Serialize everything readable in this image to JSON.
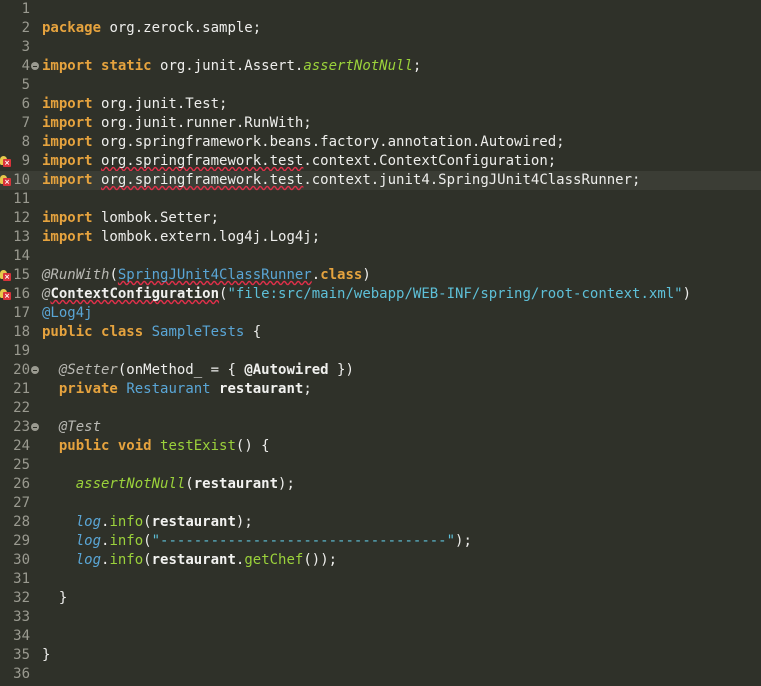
{
  "editor": {
    "lines": [
      {
        "num": "1",
        "tokens": []
      },
      {
        "num": "2",
        "tokens": [
          {
            "t": "package",
            "c": "kw"
          },
          {
            "t": " org.zerock.sample;",
            "c": "pl"
          }
        ]
      },
      {
        "num": "3",
        "tokens": []
      },
      {
        "num": "4",
        "fold": true,
        "tokens": [
          {
            "t": "import",
            "c": "kw"
          },
          {
            "t": " ",
            "c": "pl"
          },
          {
            "t": "static",
            "c": "kw"
          },
          {
            "t": " org.junit.Assert.",
            "c": "pl"
          },
          {
            "t": "assertNotNull",
            "c": "sm"
          },
          {
            "t": ";",
            "c": "pl"
          }
        ]
      },
      {
        "num": "5",
        "tokens": []
      },
      {
        "num": "6",
        "tokens": [
          {
            "t": "import",
            "c": "kw"
          },
          {
            "t": " org.junit.Test;",
            "c": "pl"
          }
        ]
      },
      {
        "num": "7",
        "tokens": [
          {
            "t": "import",
            "c": "kw"
          },
          {
            "t": " org.junit.runner.RunWith;",
            "c": "pl"
          }
        ]
      },
      {
        "num": "8",
        "tokens": [
          {
            "t": "import",
            "c": "kw"
          },
          {
            "t": " org.springframework.beans.factory.annotation.Autowired;",
            "c": "pl"
          }
        ]
      },
      {
        "num": "9",
        "error": true,
        "tokens": [
          {
            "t": "import",
            "c": "kw"
          },
          {
            "t": " ",
            "c": "pl"
          },
          {
            "t": "org.springframework.test",
            "c": "pl",
            "err": true
          },
          {
            "t": ".context.ContextConfiguration;",
            "c": "pl"
          }
        ]
      },
      {
        "num": "10",
        "error": true,
        "current": true,
        "tokens": [
          {
            "t": "import",
            "c": "kw"
          },
          {
            "t": " ",
            "c": "pl"
          },
          {
            "t": "org.springframework.test",
            "c": "pl",
            "err": true
          },
          {
            "t": ".context.junit4.SpringJUnit4ClassRunner;",
            "c": "pl"
          }
        ]
      },
      {
        "num": "11",
        "tokens": []
      },
      {
        "num": "12",
        "tokens": [
          {
            "t": "import",
            "c": "kw"
          },
          {
            "t": " lombok.Setter;",
            "c": "pl"
          }
        ]
      },
      {
        "num": "13",
        "tokens": [
          {
            "t": "import",
            "c": "kw"
          },
          {
            "t": " lombok.extern.log4j.Log4j;",
            "c": "pl"
          }
        ]
      },
      {
        "num": "14",
        "tokens": []
      },
      {
        "num": "15",
        "error": true,
        "tokens": [
          {
            "t": "@RunWith",
            "c": "an"
          },
          {
            "t": "(",
            "c": "pl"
          },
          {
            "t": "SpringJUnit4ClassRunner",
            "c": "ty",
            "err": true
          },
          {
            "t": ".",
            "c": "pl"
          },
          {
            "t": "class",
            "c": "kw"
          },
          {
            "t": ")",
            "c": "pl"
          }
        ]
      },
      {
        "num": "16",
        "error": true,
        "tokens": [
          {
            "t": "@",
            "c": "an"
          },
          {
            "t": "ContextConfiguration",
            "c": "anb",
            "err": true
          },
          {
            "t": "(",
            "c": "pl"
          },
          {
            "t": "\"file:src/main/webapp/WEB-INF/spring/root-context.xml\"",
            "c": "st"
          },
          {
            "t": ")",
            "c": "pl"
          }
        ]
      },
      {
        "num": "17",
        "tokens": [
          {
            "t": "@Log4j",
            "c": "ty"
          }
        ]
      },
      {
        "num": "18",
        "tokens": [
          {
            "t": "public",
            "c": "kw"
          },
          {
            "t": " ",
            "c": "pl"
          },
          {
            "t": "class",
            "c": "kw"
          },
          {
            "t": " ",
            "c": "pl"
          },
          {
            "t": "SampleTests",
            "c": "ty"
          },
          {
            "t": " {",
            "c": "pl"
          }
        ]
      },
      {
        "num": "19",
        "tokens": []
      },
      {
        "num": "20",
        "fold": true,
        "tokens": [
          {
            "t": "  ",
            "c": "pl"
          },
          {
            "t": "@Setter",
            "c": "an"
          },
          {
            "t": "(onMethod_ = { ",
            "c": "pl"
          },
          {
            "t": "@Autowired",
            "c": "anb"
          },
          {
            "t": " })",
            "c": "pl"
          }
        ]
      },
      {
        "num": "21",
        "tokens": [
          {
            "t": "  ",
            "c": "pl"
          },
          {
            "t": "private",
            "c": "kw"
          },
          {
            "t": " ",
            "c": "pl"
          },
          {
            "t": "Restaurant",
            "c": "ty"
          },
          {
            "t": " ",
            "c": "pl"
          },
          {
            "t": "restaurant",
            "c": "id"
          },
          {
            "t": ";",
            "c": "pl"
          }
        ]
      },
      {
        "num": "22",
        "tokens": []
      },
      {
        "num": "23",
        "fold": true,
        "tokens": [
          {
            "t": "  ",
            "c": "pl"
          },
          {
            "t": "@Test",
            "c": "an"
          }
        ]
      },
      {
        "num": "24",
        "tokens": [
          {
            "t": "  ",
            "c": "pl"
          },
          {
            "t": "public",
            "c": "kw"
          },
          {
            "t": " ",
            "c": "pl"
          },
          {
            "t": "void",
            "c": "kw"
          },
          {
            "t": " ",
            "c": "pl"
          },
          {
            "t": "testExist",
            "c": "fn"
          },
          {
            "t": "() {",
            "c": "pl"
          }
        ]
      },
      {
        "num": "25",
        "tokens": []
      },
      {
        "num": "26",
        "tokens": [
          {
            "t": "    ",
            "c": "pl"
          },
          {
            "t": "assertNotNull",
            "c": "sm"
          },
          {
            "t": "(",
            "c": "pl"
          },
          {
            "t": "restaurant",
            "c": "id"
          },
          {
            "t": ");",
            "c": "pl"
          }
        ]
      },
      {
        "num": "27",
        "tokens": []
      },
      {
        "num": "28",
        "tokens": [
          {
            "t": "    ",
            "c": "pl"
          },
          {
            "t": "log",
            "c": "fi"
          },
          {
            "t": ".",
            "c": "pl"
          },
          {
            "t": "info",
            "c": "fn"
          },
          {
            "t": "(",
            "c": "pl"
          },
          {
            "t": "restaurant",
            "c": "id"
          },
          {
            "t": ");",
            "c": "pl"
          }
        ]
      },
      {
        "num": "29",
        "tokens": [
          {
            "t": "    ",
            "c": "pl"
          },
          {
            "t": "log",
            "c": "fi"
          },
          {
            "t": ".",
            "c": "pl"
          },
          {
            "t": "info",
            "c": "fn"
          },
          {
            "t": "(",
            "c": "pl"
          },
          {
            "t": "\"----------------------------------\"",
            "c": "st"
          },
          {
            "t": ");",
            "c": "pl"
          }
        ]
      },
      {
        "num": "30",
        "tokens": [
          {
            "t": "    ",
            "c": "pl"
          },
          {
            "t": "log",
            "c": "fi"
          },
          {
            "t": ".",
            "c": "pl"
          },
          {
            "t": "info",
            "c": "fn"
          },
          {
            "t": "(",
            "c": "pl"
          },
          {
            "t": "restaurant",
            "c": "id"
          },
          {
            "t": ".",
            "c": "pl"
          },
          {
            "t": "getChef",
            "c": "fn"
          },
          {
            "t": "());",
            "c": "pl"
          }
        ]
      },
      {
        "num": "31",
        "tokens": []
      },
      {
        "num": "32",
        "tokens": [
          {
            "t": "  }",
            "c": "pl"
          }
        ]
      },
      {
        "num": "33",
        "tokens": []
      },
      {
        "num": "34",
        "tokens": []
      },
      {
        "num": "35",
        "tokens": [
          {
            "t": "}",
            "c": "pl"
          }
        ]
      },
      {
        "num": "36",
        "tokens": []
      }
    ]
  },
  "icons": {
    "fold": "collapse-icon",
    "error": "quickfix-error-icon"
  },
  "colors": {
    "background": "#2f3129",
    "current_line": "#3b3d35",
    "keyword": "#e6a33e",
    "type": "#5aa6d6",
    "string": "#5ec0d8",
    "method": "#9bd23b",
    "error_underline": "#e0304a"
  }
}
